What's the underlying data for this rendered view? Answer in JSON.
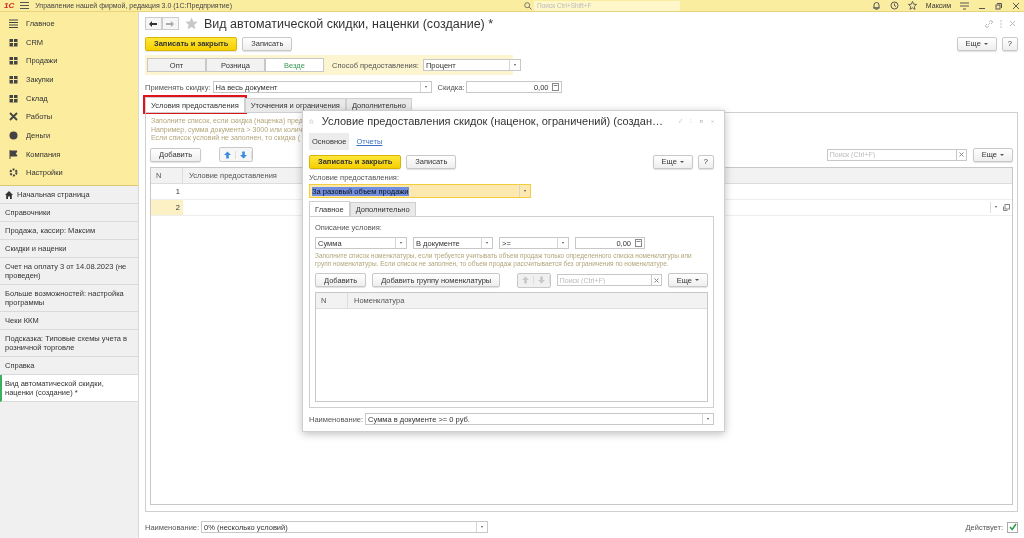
{
  "app_bar": {
    "logo": "1С",
    "title": "Управление нашей фирмой, редакция 3.0  (1С:Предприятие)",
    "search_placeholder": "Поиск Ctrl+Shift+F",
    "user": "Максим"
  },
  "sidebar": {
    "sections": [
      {
        "label": "Главное"
      },
      {
        "label": "CRM"
      },
      {
        "label": "Продажи"
      },
      {
        "label": "Закупки"
      },
      {
        "label": "Склад"
      },
      {
        "label": "Работы"
      },
      {
        "label": "Деньги"
      },
      {
        "label": "Компания"
      },
      {
        "label": "Настройки"
      }
    ],
    "open_windows": [
      {
        "label": "Начальная страница",
        "kind": "home",
        "selected": false
      },
      {
        "label": "Справочники",
        "kind": "window",
        "selected": false
      },
      {
        "label": "Продажа, кассир: Максим",
        "kind": "window",
        "selected": false
      },
      {
        "label": "Скидки и наценки",
        "kind": "window",
        "selected": false
      },
      {
        "label": "Счет на оплату 3 от 14.08.2023 (не проведен)",
        "kind": "window",
        "selected": false
      },
      {
        "label": "Больше возможностей: настройка программы",
        "kind": "window",
        "selected": false
      },
      {
        "label": "Чеки ККМ",
        "kind": "window",
        "selected": false
      },
      {
        "label": "Подсказка: Типовые схемы учета в розничной торговле",
        "kind": "window",
        "selected": false
      },
      {
        "label": "Справка",
        "kind": "window",
        "selected": false
      },
      {
        "label": "Вид автоматической скидки, наценки (создание) *",
        "kind": "window",
        "selected": true
      }
    ]
  },
  "form": {
    "title": "Вид автоматической скидки, наценки (создание) *",
    "save_close": "Записать и закрыть",
    "save": "Записать",
    "more": "Еще",
    "help": "?",
    "segments": [
      {
        "label": "Опт",
        "selected": false
      },
      {
        "label": "Розница",
        "selected": false
      },
      {
        "label": "Везде",
        "selected": true
      }
    ],
    "method": {
      "label": "Способ предоставления:",
      "value": "Процент"
    },
    "apply": {
      "label": "Применять скидку:",
      "value": "На весь документ"
    },
    "discount": {
      "label": "Скидка:",
      "value": "0,00"
    },
    "tabs": [
      {
        "label": "Условия предоставления",
        "selected": true,
        "highlighted": true
      },
      {
        "label": "Уточнения и ограничения",
        "selected": false,
        "highlighted": false
      },
      {
        "label": "Дополнительно",
        "selected": false,
        "highlighted": false
      }
    ],
    "hint": [
      "Заполните список, если скидка (наценка) пред",
      "Например, сумма документа > 3000 или колич",
      "Если список условий не заполнен, то скидка ("
    ],
    "add": "Добавить",
    "reorder": {
      "disabled": false
    },
    "search_placeholder": "Поиск (Ctrl+F)",
    "list_more": "Еще",
    "table": {
      "columns": [
        "N",
        "Условие предоставления"
      ],
      "rows": [
        {
          "n": "1",
          "selected": false
        },
        {
          "n": "2",
          "selected": true
        }
      ]
    },
    "name": {
      "label": "Наименование:",
      "value": "0% (несколько условий)"
    },
    "active": {
      "label": "Действует:",
      "checked": true
    }
  },
  "dialog": {
    "title": "Условие предоставления скидок (наценок, ограничений) (создан…",
    "nav": [
      {
        "label": "Основное",
        "selected": true
      },
      {
        "label": "Отчеты",
        "selected": false
      }
    ],
    "save_close": "Записать и закрыть",
    "save": "Записать",
    "more": "Еще",
    "help": "?",
    "condition": {
      "label": "Условие предоставления:",
      "value": "За разовый объем продажи",
      "text_selected": true
    },
    "tabs": [
      {
        "label": "Главное",
        "selected": true
      },
      {
        "label": "Дополнительно",
        "selected": false
      }
    ],
    "description_label": "Описание условия:",
    "criteria": [
      {
        "value": "Сумма",
        "kind": "select"
      },
      {
        "value": "В документе",
        "kind": "select"
      },
      {
        "value": ">=",
        "kind": "select"
      },
      {
        "value": "0,00",
        "kind": "number"
      }
    ],
    "hint": "Заполните список номенклатуры, если требуется учитывать объем продаж только определенного списка номенклатуры или групп номенклатуры. Если список не заполнен, то объем продаж рассчитывается без ограничения по номенклатуре.",
    "add": "Добавить",
    "add_group": "Добавить группу номенклатуры",
    "reorder": {
      "disabled": true
    },
    "search_placeholder": "Поиск (Ctrl+F)",
    "list_more": "Еще",
    "table": {
      "columns": [
        "N",
        "Номенклатура"
      ]
    },
    "name": {
      "label": "Наименование:",
      "value": "Сумма в документе >= 0 руб."
    }
  }
}
